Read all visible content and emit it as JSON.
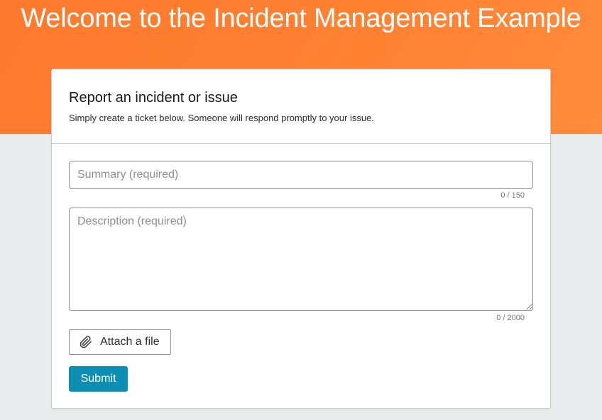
{
  "hero": {
    "title": "Welcome to the Incident Management Example"
  },
  "card": {
    "title": "Report an incident or issue",
    "subtitle": "Simply create a ticket below. Someone will respond promptly to your issue."
  },
  "form": {
    "summary": {
      "placeholder": "Summary (required)",
      "value": "",
      "counter": "0 / 150"
    },
    "description": {
      "placeholder": "Description (required)",
      "value": "",
      "counter": "0 / 2000"
    },
    "attach": {
      "label": "Attach a file",
      "icon": "paperclip-icon"
    },
    "submit_label": "Submit"
  },
  "colors": {
    "hero_background": "#ff8233",
    "submit_background": "#0d8fb4",
    "page_background": "#e9ecec"
  }
}
